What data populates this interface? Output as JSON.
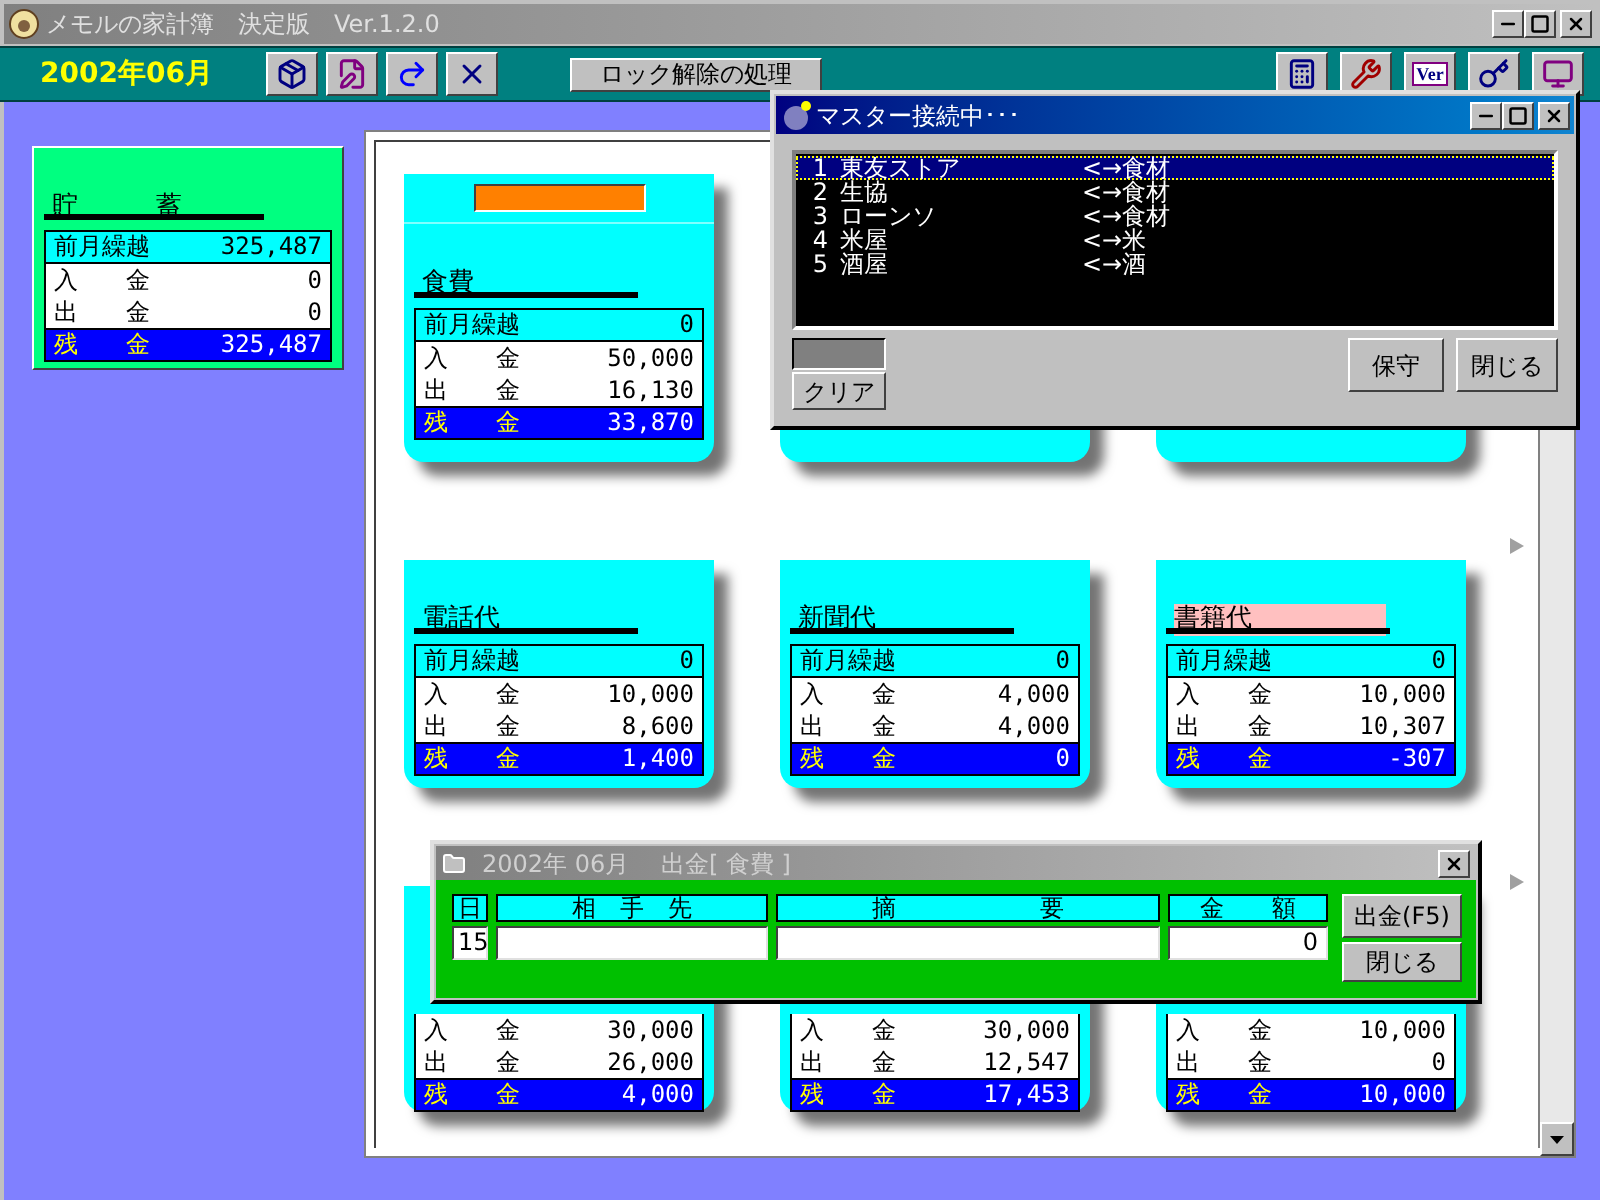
{
  "window": {
    "title": "メモルの家計簿　決定版　Ver.1.2.0"
  },
  "toolbar": {
    "date": "2002年06月",
    "lock_button": "ロック解除の処理",
    "version_button": "Ver"
  },
  "savings": {
    "title": "貯　　　蓄",
    "rows": [
      {
        "kind": "carryover",
        "label": "前月繰越",
        "value": "325,487"
      },
      {
        "kind": "entry",
        "label": "入　　金",
        "value": "0"
      },
      {
        "kind": "entry",
        "label": "出　　金",
        "value": "0"
      },
      {
        "kind": "balance",
        "label": "残　　金",
        "value": "325,487"
      }
    ]
  },
  "cards": [
    {
      "kind": "full",
      "title": "食費",
      "tab": true,
      "highlighted": false,
      "rows": [
        {
          "kind": "carryover",
          "label": "前月繰越",
          "value": "0"
        },
        {
          "kind": "entry",
          "label": "入　　金",
          "value": "50,000"
        },
        {
          "kind": "entry",
          "label": "出　　金",
          "value": "16,130"
        },
        {
          "kind": "balance",
          "label": "残　　金",
          "value": "33,870"
        }
      ]
    },
    {
      "kind": "covered"
    },
    {
      "kind": "covered"
    },
    {
      "kind": "full",
      "title": "電話代",
      "tab": false,
      "highlighted": false,
      "rows": [
        {
          "kind": "carryover",
          "label": "前月繰越",
          "value": "0"
        },
        {
          "kind": "entry",
          "label": "入　　金",
          "value": "10,000"
        },
        {
          "kind": "entry",
          "label": "出　　金",
          "value": "8,600"
        },
        {
          "kind": "balance",
          "label": "残　　金",
          "value": "1,400"
        }
      ]
    },
    {
      "kind": "full",
      "title": "新聞代",
      "tab": false,
      "highlighted": false,
      "rows": [
        {
          "kind": "carryover",
          "label": "前月繰越",
          "value": "0"
        },
        {
          "kind": "entry",
          "label": "入　　金",
          "value": "4,000"
        },
        {
          "kind": "entry",
          "label": "出　　金",
          "value": "4,000"
        },
        {
          "kind": "balance",
          "label": "残　　金",
          "value": "0"
        }
      ]
    },
    {
      "kind": "full",
      "title": "書籍代",
      "tab": false,
      "highlighted": true,
      "rows": [
        {
          "kind": "carryover",
          "label": "前月繰越",
          "value": "0"
        },
        {
          "kind": "entry",
          "label": "入　　金",
          "value": "10,000"
        },
        {
          "kind": "entry",
          "label": "出　　金",
          "value": "10,307"
        },
        {
          "kind": "balance",
          "label": "残　　金",
          "value": "-307"
        }
      ]
    },
    {
      "kind": "partial",
      "rows": [
        {
          "kind": "entry",
          "label": "入　　金",
          "value": "30,000"
        },
        {
          "kind": "entry",
          "label": "出　　金",
          "value": "26,000"
        },
        {
          "kind": "balance",
          "label": "残　　金",
          "value": "4,000"
        }
      ]
    },
    {
      "kind": "partial",
      "rows": [
        {
          "kind": "entry",
          "label": "入　　金",
          "value": "30,000"
        },
        {
          "kind": "entry",
          "label": "出　　金",
          "value": "12,547"
        },
        {
          "kind": "balance",
          "label": "残　　金",
          "value": "17,453"
        }
      ]
    },
    {
      "kind": "partial",
      "rows": [
        {
          "kind": "entry",
          "label": "入　　金",
          "value": "10,000"
        },
        {
          "kind": "entry",
          "label": "出　　金",
          "value": "0"
        },
        {
          "kind": "balance",
          "label": "残　　金",
          "value": "10,000"
        }
      ]
    }
  ],
  "master": {
    "title": "マスター接続中･･･",
    "items": [
      {
        "no": "1",
        "name": "東友ストア",
        "link": "<→食材",
        "selected": true
      },
      {
        "no": "2",
        "name": "生協",
        "link": "<→食材",
        "selected": false
      },
      {
        "no": "3",
        "name": "ローンソ",
        "link": "<→食材",
        "selected": false
      },
      {
        "no": "4",
        "name": "米屋",
        "link": "<→米",
        "selected": false
      },
      {
        "no": "5",
        "name": "酒屋",
        "link": "<→酒",
        "selected": false
      }
    ],
    "clear_button": "クリア",
    "maintain_button": "保守",
    "close_button": "閉じる"
  },
  "dialog": {
    "title": "2002年 06月　 出金[ 食費 ]",
    "columns": [
      {
        "kind": "day",
        "header": "日",
        "value": "15"
      },
      {
        "kind": "text",
        "header": "相　手　先"
      },
      {
        "kind": "wide",
        "header": "摘　　　　　　要"
      },
      {
        "kind": "amount",
        "header": "金　　額",
        "value": "0"
      }
    ],
    "submit_button": "出金(F5)",
    "close_button": "閉じる"
  }
}
